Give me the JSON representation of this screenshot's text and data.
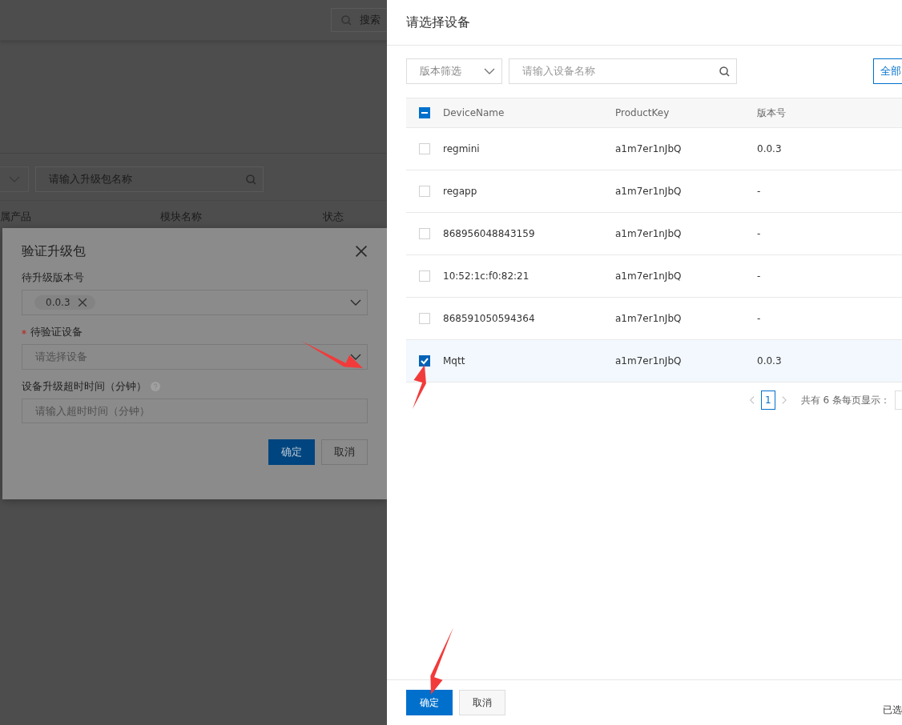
{
  "background_page": {
    "search_placeholder": "搜索",
    "package_search_placeholder": "请输入升级包名称",
    "columns": [
      "属产品",
      "模块名称",
      "状态"
    ]
  },
  "modal": {
    "title": "验证升级包",
    "fields": [
      {
        "kind": "tags",
        "label": "待升级版本号",
        "required": false,
        "help": false,
        "tags": [
          "0.0.3"
        ]
      },
      {
        "kind": "select",
        "label": "待验证设备",
        "required": true,
        "help": false,
        "placeholder": "请选择设备"
      },
      {
        "kind": "input",
        "label": "设备升级超时时间（分钟）",
        "required": false,
        "help": true,
        "placeholder": "请输入超时时间（分钟）"
      }
    ],
    "buttons": [
      {
        "label": "确定",
        "primary": true
      },
      {
        "label": "取消",
        "primary": false
      }
    ]
  },
  "drawer": {
    "title": "请选择设备",
    "version_filter": {
      "placeholder": "版本筛选"
    },
    "search": {
      "placeholder": "请输入设备名称"
    },
    "all_button": "全部",
    "table": {
      "header_indeterminate": true,
      "columns": [
        "DeviceName",
        "ProductKey",
        "版本号"
      ],
      "rows": [
        {
          "cells": [
            "regmini",
            "a1m7er1nJbQ",
            "0.0.3"
          ],
          "checked": false
        },
        {
          "cells": [
            "regapp",
            "a1m7er1nJbQ",
            "-"
          ],
          "checked": false
        },
        {
          "cells": [
            "868956048843159",
            "a1m7er1nJbQ",
            "-"
          ],
          "checked": false
        },
        {
          "cells": [
            "10:52:1c:f0:82:21",
            "a1m7er1nJbQ",
            "-"
          ],
          "checked": false
        },
        {
          "cells": [
            "868591050594364",
            "a1m7er1nJbQ",
            "-"
          ],
          "checked": false
        },
        {
          "cells": [
            "Mqtt",
            "a1m7er1nJbQ",
            "0.0.3"
          ],
          "checked": true
        }
      ]
    },
    "pagination": {
      "pages": [
        {
          "label": "1",
          "selected": true
        }
      ],
      "summary": "共有 6 条每页显示："
    },
    "buttons": [
      {
        "label": "确定",
        "primary": true
      },
      {
        "label": "取消",
        "primary": false
      }
    ],
    "selection_text": "已选"
  }
}
